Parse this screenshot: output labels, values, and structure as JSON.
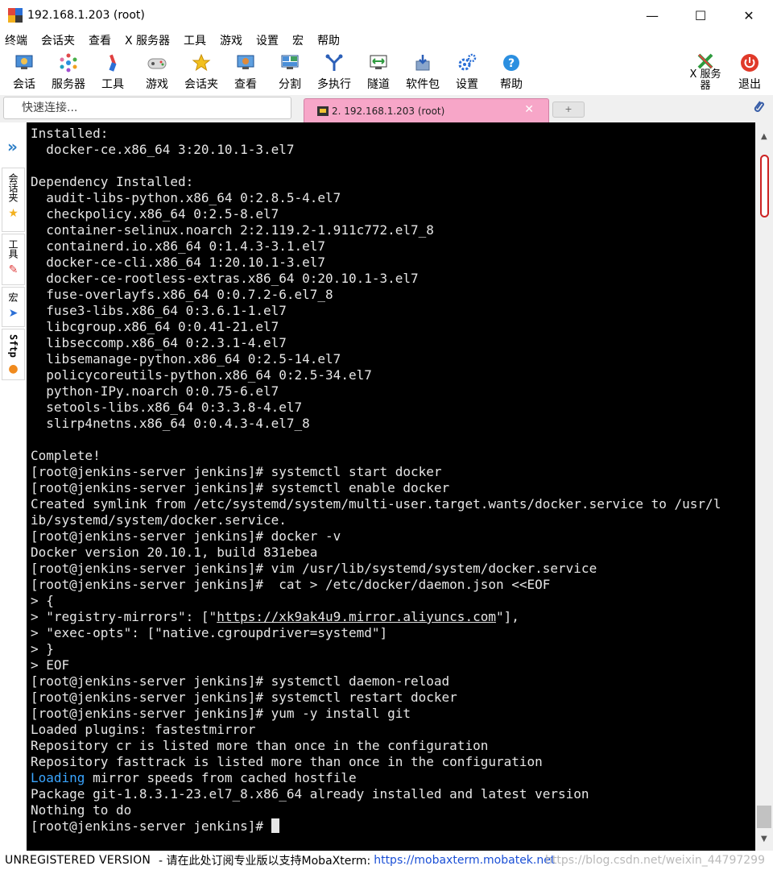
{
  "window": {
    "title": "192.168.1.203 (root)",
    "minimize": "—",
    "maximize": "☐",
    "close": "✕"
  },
  "menu": [
    "终端",
    "会话夹",
    "查看",
    "X 服务器",
    "工具",
    "游戏",
    "设置",
    "宏",
    "帮助"
  ],
  "toolbar": [
    {
      "label": "会话",
      "icon": "session-icon"
    },
    {
      "label": "服务器",
      "icon": "servers-icon"
    },
    {
      "label": "工具",
      "icon": "tools-icon"
    },
    {
      "label": "游戏",
      "icon": "games-icon"
    },
    {
      "label": "会话夹",
      "icon": "star-icon"
    },
    {
      "label": "查看",
      "icon": "view-icon"
    },
    {
      "label": "分割",
      "icon": "split-icon"
    },
    {
      "label": "多执行",
      "icon": "multiexec-icon"
    },
    {
      "label": "隧道",
      "icon": "tunnel-icon"
    },
    {
      "label": "软件包",
      "icon": "packages-icon"
    },
    {
      "label": "设置",
      "icon": "settings-icon"
    },
    {
      "label": "帮助",
      "icon": "help-icon"
    }
  ],
  "toolbar_right": {
    "xserver_line1": "X 服务",
    "xserver_line2": "器",
    "exit": "退出"
  },
  "quick_connect": {
    "placeholder": "快速连接..."
  },
  "tabs": {
    "active_label": "2. 192.168.1.203 (root)",
    "close": "✕",
    "new_tab": "+"
  },
  "side_tabs": {
    "expand": "»",
    "items": [
      {
        "label": "会话夹",
        "icon": "★"
      },
      {
        "label": "工具",
        "icon": "✎"
      },
      {
        "label": "宏",
        "icon": "➤"
      },
      {
        "label": "Sftp",
        "icon": "●"
      }
    ]
  },
  "terminal": {
    "lines": [
      "Installed:",
      "  docker-ce.x86_64 3:20.10.1-3.el7",
      "",
      "Dependency Installed:",
      "  audit-libs-python.x86_64 0:2.8.5-4.el7",
      "  checkpolicy.x86_64 0:2.5-8.el7",
      "  container-selinux.noarch 2:2.119.2-1.911c772.el7_8",
      "  containerd.io.x86_64 0:1.4.3-3.1.el7",
      "  docker-ce-cli.x86_64 1:20.10.1-3.el7",
      "  docker-ce-rootless-extras.x86_64 0:20.10.1-3.el7",
      "  fuse-overlayfs.x86_64 0:0.7.2-6.el7_8",
      "  fuse3-libs.x86_64 0:3.6.1-1.el7",
      "  libcgroup.x86_64 0:0.41-21.el7",
      "  libseccomp.x86_64 0:2.3.1-4.el7",
      "  libsemanage-python.x86_64 0:2.5-14.el7",
      "  policycoreutils-python.x86_64 0:2.5-34.el7",
      "  python-IPy.noarch 0:0.75-6.el7",
      "  setools-libs.x86_64 0:3.3.8-4.el7",
      "  slirp4netns.x86_64 0:0.4.3-4.el7_8",
      "",
      "Complete!",
      "[root@jenkins-server jenkins]# systemctl start docker",
      "[root@jenkins-server jenkins]# systemctl enable docker",
      "Created symlink from /etc/systemd/system/multi-user.target.wants/docker.service to /usr/l",
      "ib/systemd/system/docker.service.",
      "[root@jenkins-server jenkins]# docker -v",
      "Docker version 20.10.1, build 831ebea",
      "[root@jenkins-server jenkins]# vim /usr/lib/systemd/system/docker.service",
      "[root@jenkins-server jenkins]#  cat > /etc/docker/daemon.json <<EOF",
      "> {",
      "",
      "> \"exec-opts\": [\"native.cgroupdriver=systemd\"]",
      "> }",
      "> EOF",
      "[root@jenkins-server jenkins]# systemctl daemon-reload",
      "[root@jenkins-server jenkins]# systemctl restart docker",
      "[root@jenkins-server jenkins]# yum -y install git",
      "Loaded plugins: fastestmirror",
      "Repository cr is listed more than once in the configuration",
      "Repository fasttrack is listed more than once in the configuration",
      "",
      "Package git-1.8.3.1-23.el7_8.x86_64 already installed and latest version",
      "Nothing to do",
      ""
    ],
    "registry_prefix": "> \"registry-mirrors\": [\"",
    "registry_url": "https://xk9ak4u9.mirror.aliyuncs.com",
    "registry_suffix": "\"],",
    "loading_word": "Loading",
    "loading_rest": " mirror speeds from cached hostfile",
    "prompt": "[root@jenkins-server jenkins]# "
  },
  "status": {
    "unregistered": "UNREGISTERED VERSION",
    "message": "-  请在此处订阅专业版以支持MobaXterm:",
    "link": "https://mobaxterm.mobatek.net",
    "watermark": "https://blog.csdn.net/weixin_44797299"
  },
  "colors": {
    "tab_active": "#f7a6c8",
    "terminal_bg": "#000000",
    "terminal_fg": "#e6e6e6",
    "highlight_blue": "#3aa5ff",
    "link_blue": "#1a4fd6"
  }
}
